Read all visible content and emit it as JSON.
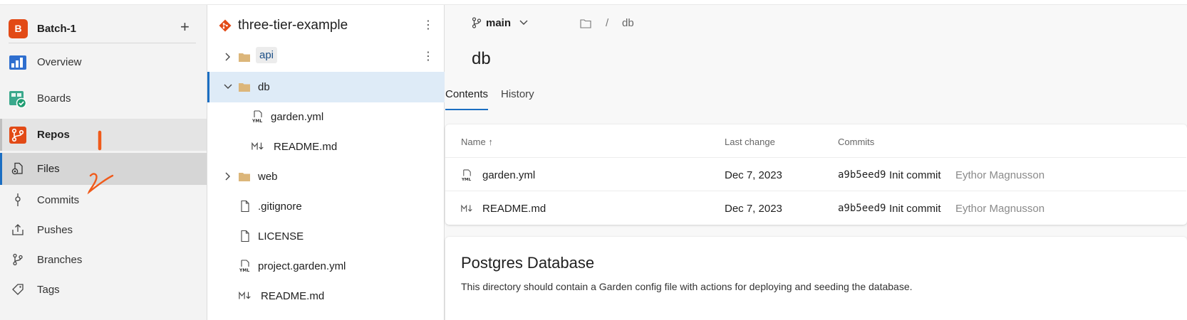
{
  "project": {
    "initial": "B",
    "name": "Batch-1",
    "add_label": "+"
  },
  "nav": {
    "overview": "Overview",
    "boards": "Boards",
    "repos": "Repos",
    "files": "Files",
    "commits": "Commits",
    "pushes": "Pushes",
    "branches": "Branches",
    "tags": "Tags"
  },
  "tree": {
    "repo_name": "three-tier-example",
    "items": [
      {
        "name": "api"
      },
      {
        "name": "db"
      },
      {
        "name": "garden.yml"
      },
      {
        "name": "README.md"
      },
      {
        "name": "web"
      },
      {
        "name": ".gitignore"
      },
      {
        "name": "LICENSE"
      },
      {
        "name": "project.garden.yml"
      },
      {
        "name": "README.md"
      }
    ]
  },
  "header": {
    "branch": "main",
    "breadcrumb_sep": "/",
    "breadcrumb_current": "db",
    "title": "db"
  },
  "tabs": {
    "contents": "Contents",
    "history": "History"
  },
  "table": {
    "columns": {
      "name": "Name",
      "sort_arrow": "↑",
      "last_change": "Last change",
      "commits": "Commits"
    },
    "rows": [
      {
        "name": "garden.yml",
        "date": "Dec 7, 2023",
        "hash": "a9b5eed9",
        "message": "Init commit",
        "author": "Eythor Magnusson"
      },
      {
        "name": "README.md",
        "date": "Dec 7, 2023",
        "hash": "a9b5eed9",
        "message": "Init commit",
        "author": "Eythor Magnusson"
      }
    ]
  },
  "readme": {
    "heading": "Postgres Database",
    "text": "This directory should contain a Garden config file with actions for deploying and seeding the database."
  },
  "colors": {
    "accent": "#1b6ec2",
    "project_badge": "#e24a16",
    "annotation": "#f05a1a"
  }
}
